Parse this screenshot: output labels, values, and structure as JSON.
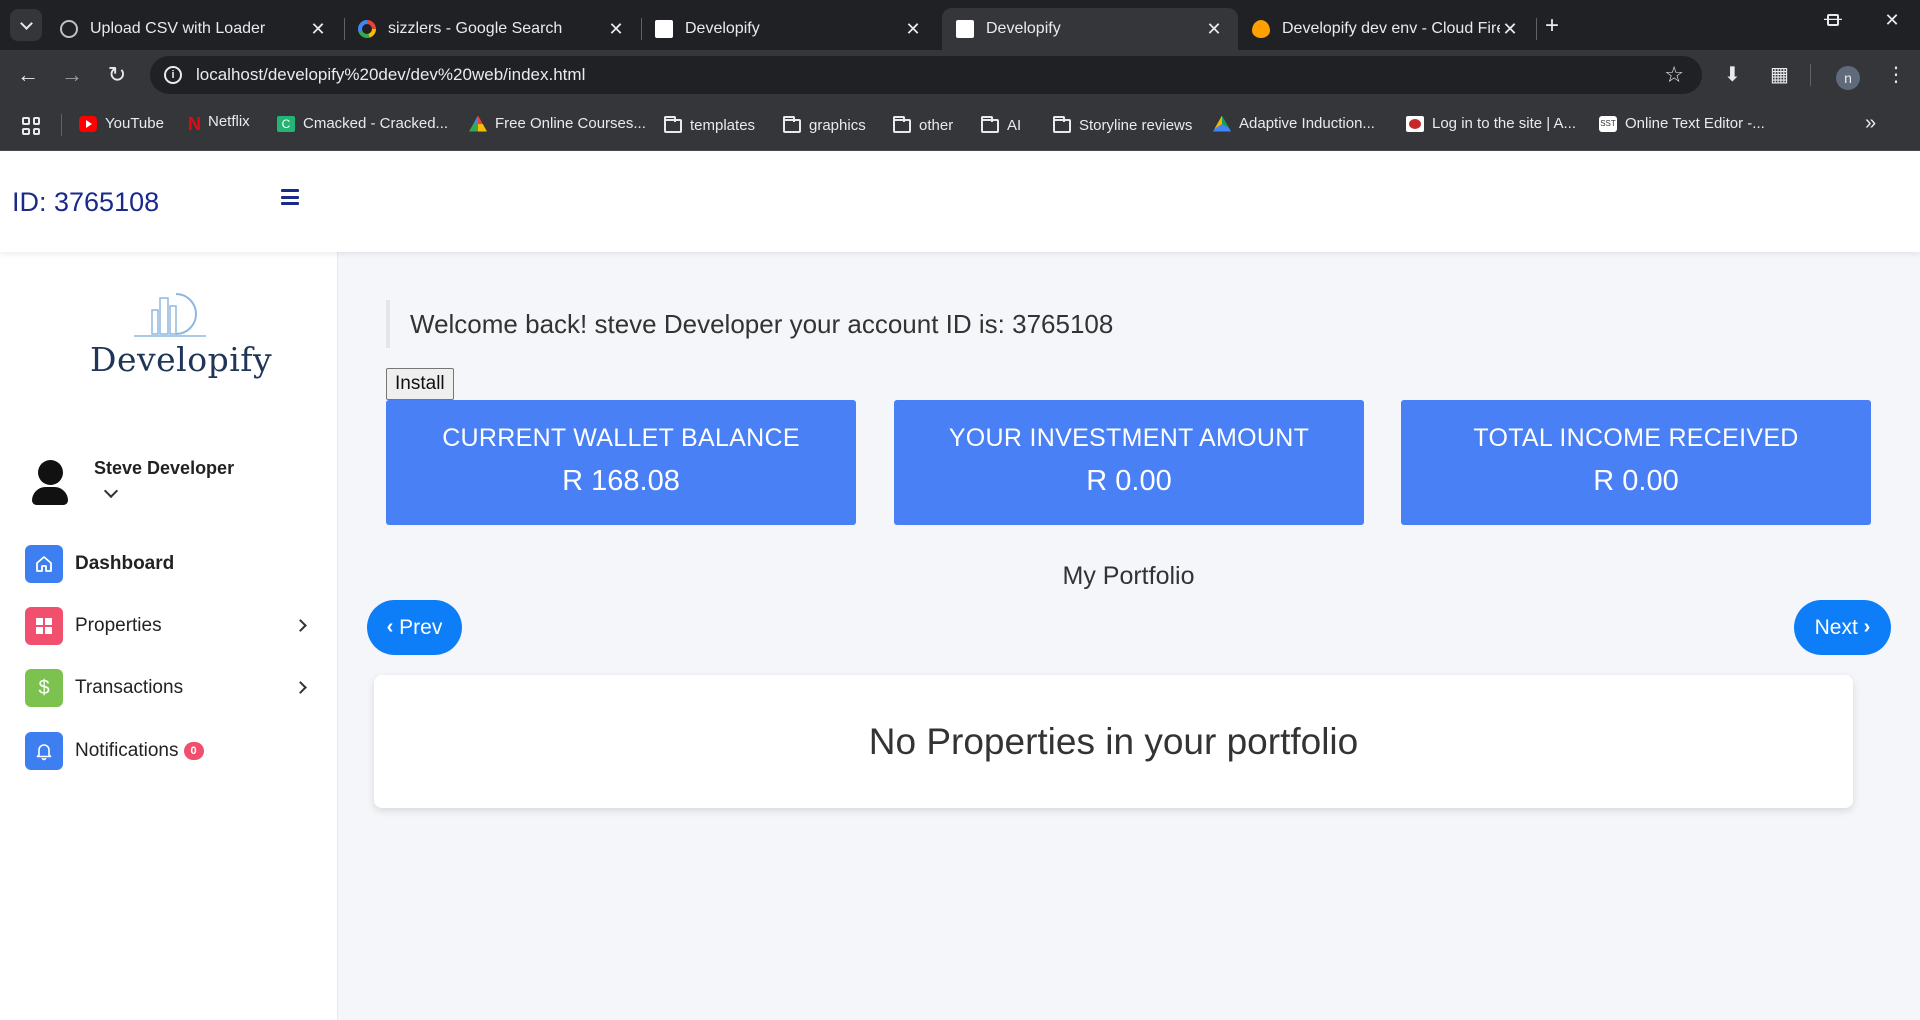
{
  "browser": {
    "tabs": [
      {
        "title": "Upload CSV with Loader",
        "favicon": "globe-icon",
        "active": false
      },
      {
        "title": "sizzlers - Google Search",
        "favicon": "google-icon",
        "active": false
      },
      {
        "title": "Developify",
        "favicon": "developify-icon",
        "active": false
      },
      {
        "title": "Developify",
        "favicon": "developify-icon",
        "active": true
      },
      {
        "title": "Developify dev env - Cloud Fire",
        "favicon": "firebase-icon",
        "active": false
      }
    ],
    "close_glyph": "✕",
    "new_tab_glyph": "+",
    "url": "localhost/developify%20dev/dev%20web/index.html",
    "profile_initial": "n",
    "bookmarks": [
      {
        "label": "YouTube",
        "icon": "youtube-icon"
      },
      {
        "label": "Netflix",
        "icon": "netflix-icon"
      },
      {
        "label": "Cmacked - Cracked...",
        "icon": "cmacked-icon"
      },
      {
        "label": "Free Online Courses...",
        "icon": "courses-icon"
      },
      {
        "label": "templates",
        "icon": "folder-icon"
      },
      {
        "label": "graphics",
        "icon": "folder-icon"
      },
      {
        "label": "other",
        "icon": "folder-icon"
      },
      {
        "label": "AI",
        "icon": "folder-icon"
      },
      {
        "label": "Storyline reviews",
        "icon": "folder-icon"
      },
      {
        "label": "Adaptive Induction...",
        "icon": "drive-icon"
      },
      {
        "label": "Log in to the site | A...",
        "icon": "login-icon"
      },
      {
        "label": "Online Text Editor -...",
        "icon": "sst-icon"
      }
    ]
  },
  "header": {
    "id_label": "ID: 3765108"
  },
  "sidebar": {
    "logo_text": "Developify",
    "user_name": "Steve Developer",
    "nav": [
      {
        "label": "Dashboard",
        "icon": "home-icon",
        "color": "#3d7ef0",
        "bold": true,
        "chevron": false
      },
      {
        "label": "Properties",
        "icon": "grid-icon",
        "color": "#f0506e",
        "bold": false,
        "chevron": true
      },
      {
        "label": "Transactions",
        "icon": "dollar-icon",
        "color": "#7cc24e",
        "bold": false,
        "chevron": true
      },
      {
        "label": "Notifications",
        "icon": "bell-icon",
        "color": "#3d7ef0",
        "bold": false,
        "chevron": false,
        "badge": "0"
      }
    ]
  },
  "main": {
    "welcome": "Welcome back! steve Developer your account ID is: 3765108",
    "install_label": "Install",
    "cards": [
      {
        "title": "CURRENT WALLET BALANCE",
        "value": "R 168.08"
      },
      {
        "title": "YOUR INVESTMENT AMOUNT",
        "value": "R 0.00"
      },
      {
        "title": "TOTAL INCOME RECEIVED",
        "value": "R 0.00"
      }
    ],
    "portfolio_title": "My Portfolio",
    "prev_label": "Prev",
    "next_label": "Next",
    "empty_message": "No Properties in your portfolio"
  },
  "colors": {
    "card_bg": "#4a80f5",
    "pill_bg": "#0d7ef8",
    "header_text": "#1a2a8a",
    "badge": "#f0506e"
  }
}
